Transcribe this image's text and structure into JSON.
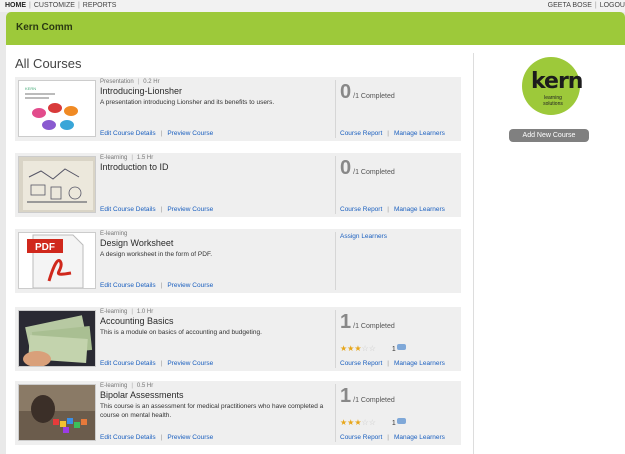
{
  "topnav": {
    "home": "HOME",
    "customize": "CUSTOMIZE",
    "reports": "REPORTS",
    "user": "GEETA BOSE",
    "logout": "LOGOU"
  },
  "banner": {
    "title": "Kern Comm"
  },
  "page_title": "All Courses",
  "courses": [
    {
      "type": "Presentation",
      "duration": "0.2 Hr",
      "title": "Introducing-Lionsher",
      "description": "A presentation introducing Lionsher and its benefits to users.",
      "edit": "Edit Course Details",
      "preview": "Preview Course",
      "completed_count": "0",
      "completed_label": "/1 Completed",
      "report": "Course Report",
      "manage": "Manage Learners"
    },
    {
      "type": "E-learning",
      "duration": "1.5 Hr",
      "title": "Introduction to ID",
      "description": "",
      "edit": "Edit Course Details",
      "preview": "Preview Course",
      "completed_count": "0",
      "completed_label": "/1 Completed",
      "report": "Course Report",
      "manage": "Manage Learners"
    },
    {
      "type": "E-learning",
      "title": "Design Worksheet",
      "description": "A design worksheet in the form of PDF.",
      "edit": "Edit Course Details",
      "preview": "Preview Course",
      "assign": "Assign Learners",
      "thumb_label": "PDF"
    },
    {
      "type": "E-learning",
      "duration": "1.0 Hr",
      "title": "Accounting Basics",
      "description": "This is a module on basics of accounting and budgeting.",
      "edit": "Edit Course Details",
      "preview": "Preview Course",
      "completed_count": "1",
      "completed_label": "/1 Completed",
      "rating": 3,
      "comments": "1",
      "report": "Course Report",
      "manage": "Manage Learners"
    },
    {
      "type": "E-learning",
      "duration": "0.5 Hr",
      "title": "Bipolar Assessments",
      "description": "This course is an assessment for medical practitioners who have completed a course on mental health.",
      "edit": "Edit Course Details",
      "preview": "Preview Course",
      "completed_count": "1",
      "completed_label": "/1 Completed",
      "rating": 3,
      "comments": "1",
      "report": "Course Report",
      "manage": "Manage Learners"
    }
  ],
  "sidebar": {
    "logo_word": "kern",
    "logo_sub": "learning solutions",
    "add_button": "Add New Course"
  },
  "colors": {
    "brand_green": "#9dc93a",
    "link_blue": "#1a5fbf",
    "star": "#e7a61a"
  },
  "icons": [
    "star-icon",
    "comment-icon",
    "pdf-icon"
  ]
}
